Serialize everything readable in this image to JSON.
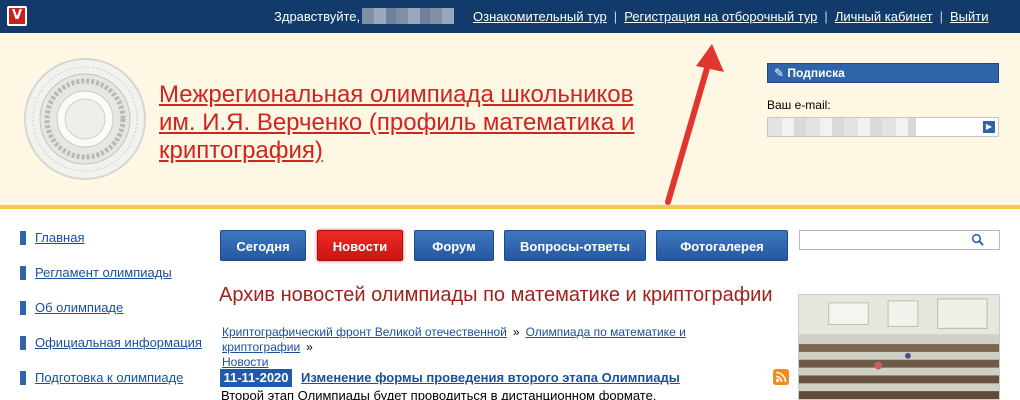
{
  "topbar": {
    "logo_letter": "V",
    "greeting": "Здравствуйте,",
    "links": [
      {
        "label": "Ознакомительный тур"
      },
      {
        "label": "Регистрация на отборочный тур"
      },
      {
        "label": "Личный кабинет"
      },
      {
        "label": "Выйти"
      }
    ]
  },
  "header": {
    "title": "Межрегиональная олимпиада школьников им. И.Я. Верченко (профиль математика и криптография)"
  },
  "subscription": {
    "header": "Подписка",
    "email_label": "Ваш e-mail:"
  },
  "sidebar": {
    "items": [
      {
        "label": "Главная"
      },
      {
        "label": "Регламент олимпиады"
      },
      {
        "label": "Об олимпиаде"
      },
      {
        "label": "Официальная информация"
      },
      {
        "label": "Подготовка к олимпиаде"
      }
    ]
  },
  "nav": {
    "buttons": [
      {
        "label": "Сегодня",
        "active": false
      },
      {
        "label": "Новости",
        "active": true
      },
      {
        "label": "Форум",
        "active": false
      },
      {
        "label": "Вопросы-ответы",
        "active": false
      },
      {
        "label": "Фотогалерея",
        "active": false
      }
    ]
  },
  "main": {
    "heading": "Архив новостей олимпиады по математике и криптографии",
    "breadcrumb": [
      {
        "label": "Криптографический фронт Великой отечественной"
      },
      {
        "label": "Олимпиада по математике и криптографии"
      },
      {
        "label": "Новости"
      }
    ],
    "breadcrumb_separator": "»",
    "news": [
      {
        "date": "11-11-2020",
        "title": "Изменение формы проведения второго этапа Олимпиады",
        "text": "Второй этап Олимпиады будет проводиться в дистанционном формате."
      }
    ]
  },
  "colors": {
    "topbar": "#123a6b",
    "header_bg": "#fdf7e3",
    "title": "#d0241f",
    "nav_blue": "#2f64a8",
    "nav_active": "#e0201b",
    "heading": "#a1211c",
    "annotation_arrow": "#e0362f"
  },
  "icons": {
    "logo": "v-logo-icon",
    "subscribe": "pencil-icon",
    "email_submit": "arrow-right-icon",
    "search": "search-icon",
    "rss": "rss-icon"
  }
}
